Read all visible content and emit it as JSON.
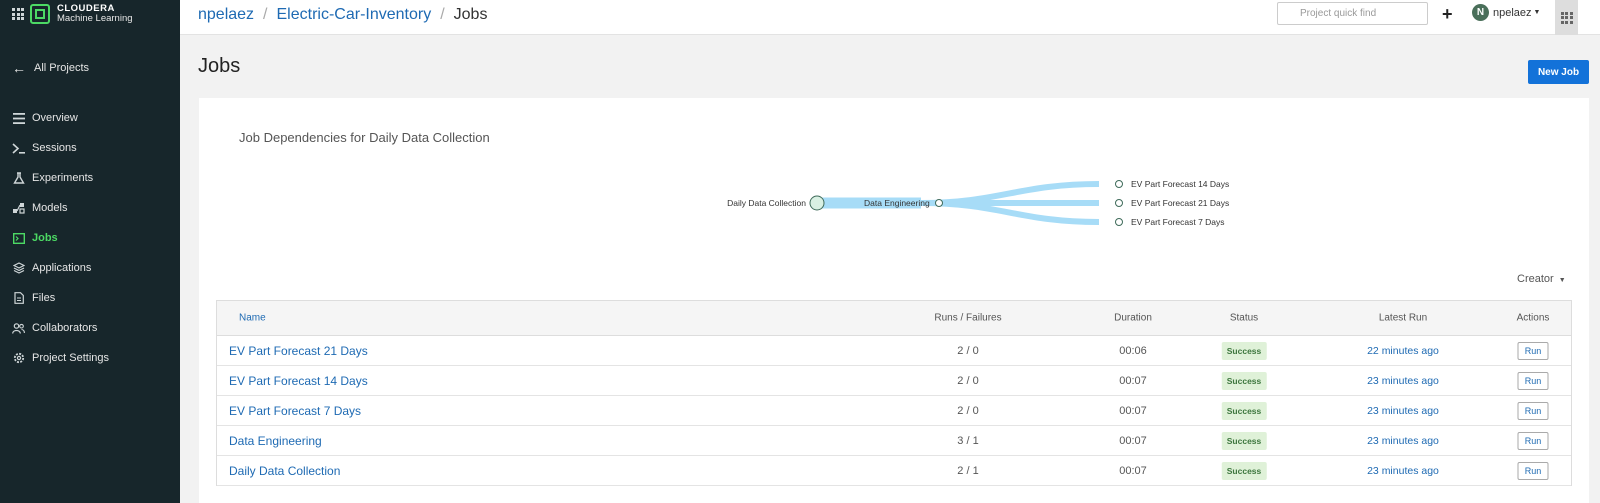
{
  "brand": {
    "name": "CLOUDERA",
    "product": "Machine Learning"
  },
  "sidebar": {
    "back_label": "All Projects",
    "items": [
      {
        "label": "Overview",
        "icon": "overview-icon",
        "active": false
      },
      {
        "label": "Sessions",
        "icon": "terminal-icon",
        "active": false
      },
      {
        "label": "Experiments",
        "icon": "flask-icon",
        "active": false
      },
      {
        "label": "Models",
        "icon": "models-icon",
        "active": false
      },
      {
        "label": "Jobs",
        "icon": "jobs-icon",
        "active": true
      },
      {
        "label": "Applications",
        "icon": "layers-icon",
        "active": false
      },
      {
        "label": "Files",
        "icon": "file-icon",
        "active": false
      },
      {
        "label": "Collaborators",
        "icon": "people-icon",
        "active": false
      },
      {
        "label": "Project Settings",
        "icon": "gear-icon",
        "active": false
      }
    ]
  },
  "header": {
    "breadcrumb": {
      "user": "npelaez",
      "project": "Electric-Car-Inventory",
      "current": "Jobs"
    },
    "search_placeholder": "Project quick find",
    "plus": "+",
    "avatar_initial": "N",
    "username": "npelaez"
  },
  "page": {
    "title": "Jobs",
    "new_job_label": "New Job"
  },
  "dependencies": {
    "title": "Job Dependencies for Daily Data Collection",
    "root": "Daily Data Collection",
    "middle": "Data Engineering",
    "leaves": [
      "EV Part Forecast 14 Days",
      "EV Part Forecast 21 Days",
      "EV Part Forecast 7 Days"
    ]
  },
  "filter": {
    "creator_label": "Creator"
  },
  "table": {
    "columns": {
      "name": "Name",
      "runs": "Runs / Failures",
      "duration": "Duration",
      "status": "Status",
      "last_run": "Latest Run",
      "actions": "Actions"
    },
    "rows": [
      {
        "name": "EV Part Forecast 21 Days",
        "runs": "2 / 0",
        "duration": "00:06",
        "status": "Success",
        "last_run": "22 minutes ago",
        "action": "Run"
      },
      {
        "name": "EV Part Forecast 14 Days",
        "runs": "2 / 0",
        "duration": "00:07",
        "status": "Success",
        "last_run": "23 minutes ago",
        "action": "Run"
      },
      {
        "name": "EV Part Forecast 7 Days",
        "runs": "2 / 0",
        "duration": "00:07",
        "status": "Success",
        "last_run": "23 minutes ago",
        "action": "Run"
      },
      {
        "name": "Data Engineering",
        "runs": "3 / 1",
        "duration": "00:07",
        "status": "Success",
        "last_run": "23 minutes ago",
        "action": "Run"
      },
      {
        "name": "Daily Data Collection",
        "runs": "2 / 1",
        "duration": "00:07",
        "status": "Success",
        "last_run": "23 minutes ago",
        "action": "Run"
      }
    ]
  },
  "colors": {
    "sidebar_bg": "#17262b",
    "accent_green": "#4cd964",
    "link_blue": "#1e6ab3",
    "primary_button": "#1372d9",
    "success_bg": "#dff1d8",
    "flow_blue": "#a7dcf7"
  }
}
